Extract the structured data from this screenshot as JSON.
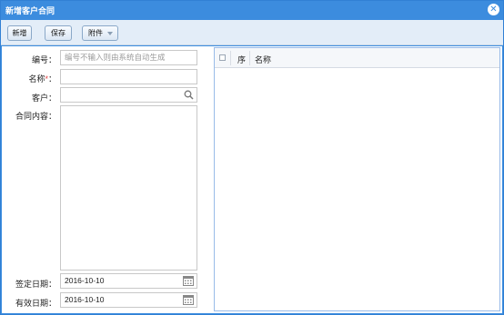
{
  "window": {
    "title": "新增客户合同",
    "close_glyph": "✕"
  },
  "toolbar": {
    "new_label": "新增",
    "save_label": "保存",
    "attach_label": "附件"
  },
  "form": {
    "number": {
      "label": "编号：",
      "placeholder": "编号不输入则由系统自动生成",
      "value": ""
    },
    "name": {
      "label": "名称",
      "required_mark": "*",
      "colon": "：",
      "value": ""
    },
    "customer": {
      "label": "客户：",
      "value": ""
    },
    "content": {
      "label": "合同内容：",
      "value": ""
    },
    "sign_date": {
      "label": "签定日期：",
      "value": "2016-10-10"
    },
    "valid_date": {
      "label": "有效日期：",
      "value": "2016-10-10"
    }
  },
  "grid": {
    "columns": [
      "序",
      "名称"
    ],
    "rows": []
  }
}
